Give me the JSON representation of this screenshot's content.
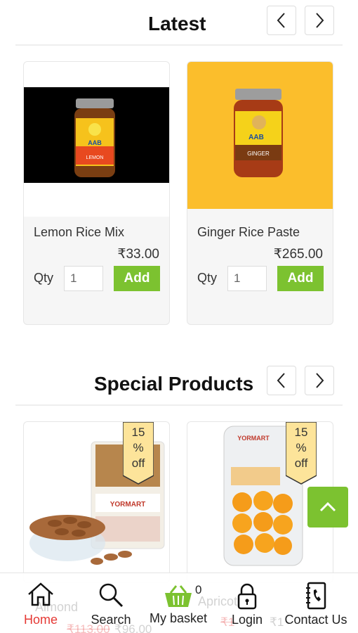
{
  "latest": {
    "title": "Latest",
    "products": [
      {
        "name": "Lemon Rice Mix",
        "price": "₹33.00",
        "qty_label": "Qty",
        "qty_value": "1",
        "add_label": "Add",
        "image_bg": "#000000"
      },
      {
        "name": "Ginger Rice Paste",
        "price": "₹265.00",
        "qty_label": "Qty",
        "qty_value": "1",
        "add_label": "Add",
        "image_bg": "#fbbe2c"
      }
    ]
  },
  "special": {
    "title": "Special Products",
    "products": [
      {
        "name": "Almond",
        "badge_lines": [
          "15",
          "%",
          "off"
        ],
        "old_price": "₹113.00",
        "price": "₹96.00"
      },
      {
        "name": "Apricot",
        "badge_lines": [
          "15",
          "%",
          "off"
        ],
        "old_price": "₹1",
        "price": "₹1"
      }
    ]
  },
  "bottom_nav": {
    "items": [
      {
        "label": "Home",
        "icon": "home-icon",
        "active": true
      },
      {
        "label": "Search",
        "icon": "search-icon",
        "active": false
      },
      {
        "label": "My basket",
        "icon": "basket-icon",
        "active": false
      },
      {
        "label": "Login",
        "icon": "lock-icon",
        "active": false
      },
      {
        "label": "Contact Us",
        "icon": "phone-book-icon",
        "active": false
      }
    ],
    "basket_count": "0"
  },
  "colors": {
    "accent": "#7cc230",
    "active_nav": "#e53935",
    "badge": "#fde49a"
  }
}
